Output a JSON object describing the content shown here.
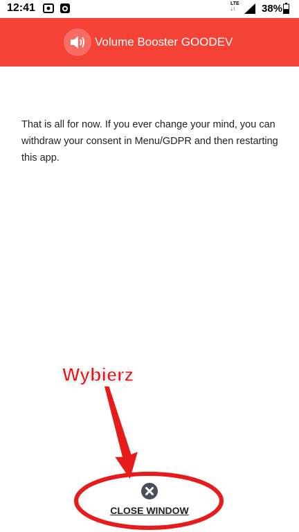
{
  "status_bar": {
    "time": "12:41",
    "network": "LTE",
    "battery": "38%",
    "icons": [
      "cast-icon",
      "app-notification-icon",
      "signal-icon",
      "battery-icon"
    ]
  },
  "app_bar": {
    "title": "Volume Booster GOODEV",
    "icon": "speaker-icon",
    "color": "#f44336"
  },
  "content": {
    "message": "That is all for now. If you ever change your mind, you can withdraw your consent in Menu/GDPR and then restarting this app."
  },
  "close_button": {
    "label": "CLOSE WINDOW",
    "icon": "close-circle-icon"
  },
  "annotation": {
    "label": "Wybierz",
    "color": "#ee1111"
  }
}
